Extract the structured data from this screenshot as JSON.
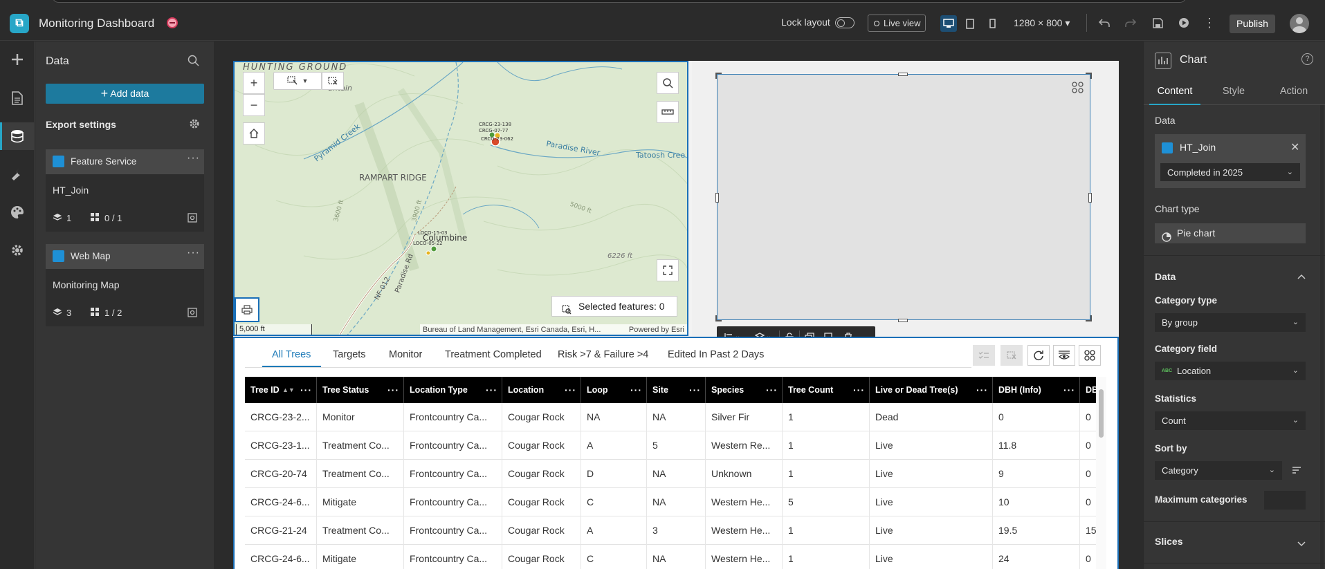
{
  "header": {
    "app_title": "Monitoring Dashboard",
    "lock_layout_label": "Lock layout",
    "live_view_label": "Live view",
    "resolution": "1280 × 800",
    "publish_label": "Publish"
  },
  "data_panel": {
    "title": "Data",
    "add_data_label": "Add data",
    "export_settings_label": "Export settings",
    "sources": [
      {
        "type_label": "Feature Service",
        "name": "HT_Join",
        "layers": "1",
        "views": "0 / 1"
      },
      {
        "type_label": "Web Map",
        "name": "Monitoring Map",
        "layers": "3",
        "views": "1 / 2"
      }
    ]
  },
  "map": {
    "labels": {
      "hunting_ground": "HUNTING GROUND",
      "mountain": "untain",
      "pyramid_creek": "Pyramid Creek",
      "rampart_ridge": "RAMPART RIDGE",
      "paradise_river": "Paradise River",
      "tatoosh_creek": "Tatoosh Cree",
      "columbine": "Columbine",
      "paradise_rd": "Paradise Rd",
      "nf012": "NF-012",
      "elev_3600": "3600 ft",
      "elev_3900": "3900 ft",
      "elev_5000": "5000 ft",
      "elev_6226": "6226 ft",
      "pt1": "CRCG-23-138",
      "pt2": "CRCG-07-77",
      "pt3": "CRCG-23-062",
      "pt4": "LOCO-15-03",
      "pt5": "LOCO-05-22"
    },
    "scale_label": "5,000 ft",
    "attribution": "Bureau of Land Management, Esri Canada, Esri, H...",
    "powered_by": "Powered by Esri",
    "selected_features_label": "Selected features: 0"
  },
  "table": {
    "tabs": [
      "All Trees",
      "Targets",
      "Monitor",
      "Treatment Completed",
      "Risk >7 & Failure >4",
      "Edited In Past 2 Days"
    ],
    "columns": [
      "Tree ID",
      "Tree Status",
      "Location Type",
      "Location",
      "Loop",
      "Site",
      "Species",
      "Tree Count",
      "Live or Dead Tree(s)",
      "DBH (Info)",
      "DB"
    ],
    "rows": [
      [
        "CRCG-23-2...",
        "Monitor",
        "Frontcountry Ca...",
        "Cougar Rock",
        "NA",
        "NA",
        "Silver Fir",
        "1",
        "Dead",
        "0",
        "0"
      ],
      [
        "CRCG-23-1...",
        "Treatment Co...",
        "Frontcountry Ca...",
        "Cougar Rock",
        "A",
        "5",
        "Western Re...",
        "1",
        "Live",
        "11.8",
        "0"
      ],
      [
        "CRCG-20-74",
        "Treatment Co...",
        "Frontcountry Ca...",
        "Cougar Rock",
        "D",
        "NA",
        "Unknown",
        "1",
        "Live",
        "9",
        "0"
      ],
      [
        "CRCG-24-6...",
        "Mitigate",
        "Frontcountry Ca...",
        "Cougar Rock",
        "C",
        "NA",
        "Western He...",
        "5",
        "Live",
        "10",
        "0"
      ],
      [
        "CRCG-21-24",
        "Treatment Co...",
        "Frontcountry Ca...",
        "Cougar Rock",
        "A",
        "3",
        "Western He...",
        "1",
        "Live",
        "19.5",
        "15"
      ],
      [
        "CRCG-24-6...",
        "Mitigate",
        "Frontcountry Ca...",
        "Cougar Rock",
        "C",
        "NA",
        "Western He...",
        "1",
        "Live",
        "24",
        "0"
      ]
    ]
  },
  "settings": {
    "title": "Chart",
    "tabs": [
      "Content",
      "Style",
      "Action"
    ],
    "data_label": "Data",
    "data_source": "HT_Join",
    "view": "Completed in 2025",
    "chart_type_label": "Chart type",
    "chart_type": "Pie chart",
    "data_section_label": "Data",
    "category_type_label": "Category type",
    "category_type": "By group",
    "category_field_label": "Category field",
    "category_field": "Location",
    "statistics_label": "Statistics",
    "statistics": "Count",
    "sort_by_label": "Sort by",
    "sort_by": "Category",
    "max_categories_label": "Maximum categories",
    "slices_label": "Slices"
  },
  "colors": {
    "accent": "#27a6c7",
    "selection_blue": "#1a6fb8",
    "table_header": "#000000"
  }
}
